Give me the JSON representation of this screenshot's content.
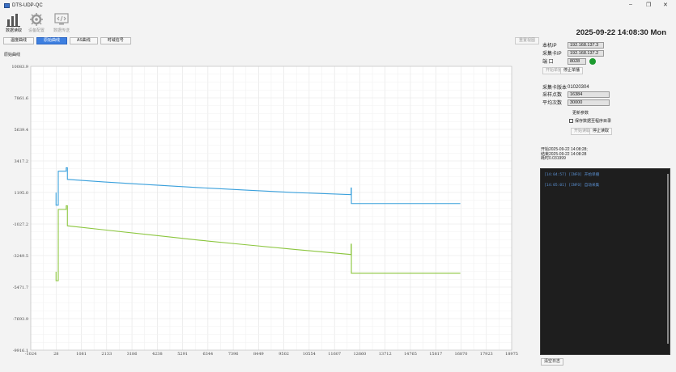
{
  "window": {
    "title": "DTS-UDP-QC",
    "minimize": "–",
    "maximize": "❐",
    "close": "✕"
  },
  "toolbar": {
    "tools": [
      {
        "label": "数据读取",
        "icon": "bar-chart-icon",
        "enabled": true
      },
      {
        "label": "设备配置",
        "icon": "gear-icon",
        "enabled": false
      },
      {
        "label": "数据传送",
        "icon": "code-monitor-icon",
        "enabled": false
      }
    ],
    "datetime": "2025-09-22 14:08:30 Mon"
  },
  "tabs": [
    "温度曲线",
    "原始曲线",
    "AS曲线",
    "时域信号"
  ],
  "active_tab": 1,
  "clear_button": "重置视图",
  "chart_title": "原始曲线",
  "chart_data": {
    "type": "line",
    "xlim": [
      -1024,
      18975
    ],
    "ylim": [
      -9914.1,
      10083.9
    ],
    "x_ticks": [
      "-1024",
      "28",
      "1081",
      "2133",
      "3186",
      "4238",
      "5291",
      "6344",
      "7396",
      "8449",
      "9502",
      "10554",
      "11607",
      "12660",
      "13712",
      "14765",
      "15817",
      "16870",
      "17923",
      "18975"
    ],
    "y_ticks": [
      "10083.9",
      "7861.6",
      "5639.4",
      "3417.2",
      "1195.0",
      "-1027.2",
      "-3249.5",
      "-5471.7",
      "-7693.9",
      "-9916.1"
    ],
    "grid": true,
    "colors": [
      "#3aa0dc",
      "#8cc63f"
    ],
    "series": [
      {
        "values": [
          [
            28,
            1190
          ],
          [
            28,
            301
          ],
          [
            120,
            301
          ],
          [
            120,
            2697
          ],
          [
            450,
            2697
          ],
          [
            450,
            2936
          ],
          [
            500,
            2936
          ],
          [
            500,
            2116
          ],
          [
            2000,
            1941
          ],
          [
            4000,
            1733
          ],
          [
            6000,
            1535
          ],
          [
            8000,
            1356
          ],
          [
            10000,
            1188
          ],
          [
            12300,
            1042
          ],
          [
            12300,
            1515
          ],
          [
            12310,
            1515
          ],
          [
            12310,
            412
          ],
          [
            16840,
            412
          ]
        ]
      },
      {
        "values": [
          [
            28,
            -4390
          ],
          [
            28,
            -5021
          ],
          [
            120,
            -5021
          ],
          [
            120,
            0
          ],
          [
            450,
            0
          ],
          [
            450,
            263
          ],
          [
            500,
            263
          ],
          [
            500,
            -1153
          ],
          [
            2000,
            -1433
          ],
          [
            4000,
            -1800
          ],
          [
            6000,
            -2168
          ],
          [
            8000,
            -2500
          ],
          [
            10000,
            -2824
          ],
          [
            12300,
            -3175
          ],
          [
            12300,
            -2449
          ],
          [
            12310,
            -2449
          ],
          [
            12310,
            -4497
          ],
          [
            16840,
            -4497
          ]
        ]
      }
    ]
  },
  "panel": {
    "local_ip_label": "本机IP",
    "local_ip": "192.168.137.3",
    "card_ip_label": "采集卡IP",
    "card_ip": "192.168.137.2",
    "port_label": "端 口",
    "port": "8028",
    "start_single": "开始单播",
    "stop_single": "停止单播",
    "card_version_label": "采集卡版本",
    "card_version": "01020304",
    "sample_points_label": "采样点数",
    "sample_points": "16384",
    "avg_count_label": "平均次数",
    "avg_count": "30000",
    "update_params": "更新参数",
    "save_checkbox": "保存数据至程序目录",
    "start_read": "开始读取",
    "stop_read": "停止读取"
  },
  "timing": {
    "start": "开始2025-09-22 14:08:28;",
    "end": "结束2025-09-22 14:08:28",
    "elapsed": "耗时0.031999"
  },
  "log": [
    "[14:04:57] [INFO] 开始单播",
    "[14:05:01] [INFO] 自动采集"
  ],
  "clear_log": "清空日志"
}
